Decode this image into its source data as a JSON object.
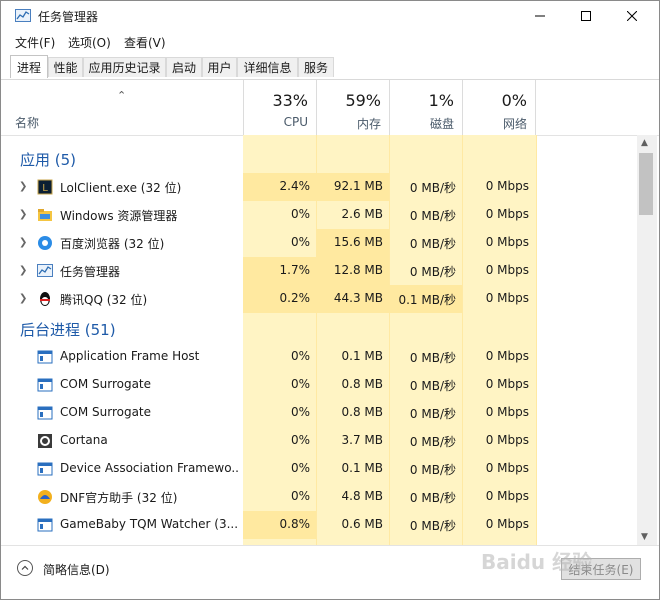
{
  "window": {
    "title": "任务管理器",
    "icon": "task-manager-icon",
    "controls": [
      "minimize-icon",
      "maximize-icon",
      "close-icon"
    ]
  },
  "menu": [
    "文件(F)",
    "选项(O)",
    "查看(V)"
  ],
  "tabs": [
    "进程",
    "性能",
    "应用历史记录",
    "启动",
    "用户",
    "详细信息",
    "服务"
  ],
  "active_tab": "进程",
  "columns": {
    "name": "名称",
    "cpu": {
      "pct": "33%",
      "label": "CPU"
    },
    "mem": {
      "pct": "59%",
      "label": "内存"
    },
    "disk": {
      "pct": "1%",
      "label": "磁盘"
    },
    "net": {
      "pct": "0%",
      "label": "网络"
    }
  },
  "groups": [
    {
      "title": "应用 (5)",
      "rows": [
        {
          "name": "LolClient.exe (32 位)",
          "icon": "league-icon",
          "expandable": true,
          "cpu": "2.4%",
          "mem": "92.1 MB",
          "disk": "0 MB/秒",
          "net": "0 Mbps"
        },
        {
          "name": "Windows 资源管理器",
          "icon": "folder-icon",
          "expandable": true,
          "cpu": "0%",
          "mem": "2.6 MB",
          "disk": "0 MB/秒",
          "net": "0 Mbps"
        },
        {
          "name": "百度浏览器 (32 位)",
          "icon": "baidu-browser-icon",
          "expandable": true,
          "cpu": "0%",
          "mem": "15.6 MB",
          "disk": "0 MB/秒",
          "net": "0 Mbps"
        },
        {
          "name": "任务管理器",
          "icon": "task-manager-icon",
          "expandable": true,
          "cpu": "1.7%",
          "mem": "12.8 MB",
          "disk": "0 MB/秒",
          "net": "0 Mbps"
        },
        {
          "name": "腾讯QQ (32 位)",
          "icon": "qq-penguin-icon",
          "expandable": true,
          "cpu": "0.2%",
          "mem": "44.3 MB",
          "disk": "0.1 MB/秒",
          "net": "0 Mbps"
        }
      ]
    },
    {
      "title": "后台进程 (51)",
      "rows": [
        {
          "name": "Application Frame Host",
          "icon": "app-window-icon",
          "expandable": false,
          "cpu": "0%",
          "mem": "0.1 MB",
          "disk": "0 MB/秒",
          "net": "0 Mbps"
        },
        {
          "name": "COM Surrogate",
          "icon": "app-window-icon",
          "expandable": false,
          "cpu": "0%",
          "mem": "0.8 MB",
          "disk": "0 MB/秒",
          "net": "0 Mbps"
        },
        {
          "name": "COM Surrogate",
          "icon": "app-window-icon",
          "expandable": false,
          "cpu": "0%",
          "mem": "0.8 MB",
          "disk": "0 MB/秒",
          "net": "0 Mbps"
        },
        {
          "name": "Cortana",
          "icon": "cortana-icon",
          "expandable": false,
          "cpu": "0%",
          "mem": "3.7 MB",
          "disk": "0 MB/秒",
          "net": "0 Mbps"
        },
        {
          "name": "Device Association Framewo...",
          "icon": "app-window-icon",
          "expandable": false,
          "cpu": "0%",
          "mem": "0.1 MB",
          "disk": "0 MB/秒",
          "net": "0 Mbps"
        },
        {
          "name": "DNF官方助手 (32 位)",
          "icon": "dnf-helper-icon",
          "expandable": false,
          "cpu": "0%",
          "mem": "4.8 MB",
          "disk": "0 MB/秒",
          "net": "0 Mbps"
        },
        {
          "name": "GameBaby TQM Watcher (3...",
          "icon": "app-window-icon",
          "expandable": false,
          "cpu": "0.8%",
          "mem": "0.6 MB",
          "disk": "0 MB/秒",
          "net": "0 Mbps"
        }
      ]
    }
  ],
  "footer": {
    "less_details": "简略信息(D)",
    "end_task": "结束任务(E)"
  },
  "watermark": "Baidu 经验"
}
